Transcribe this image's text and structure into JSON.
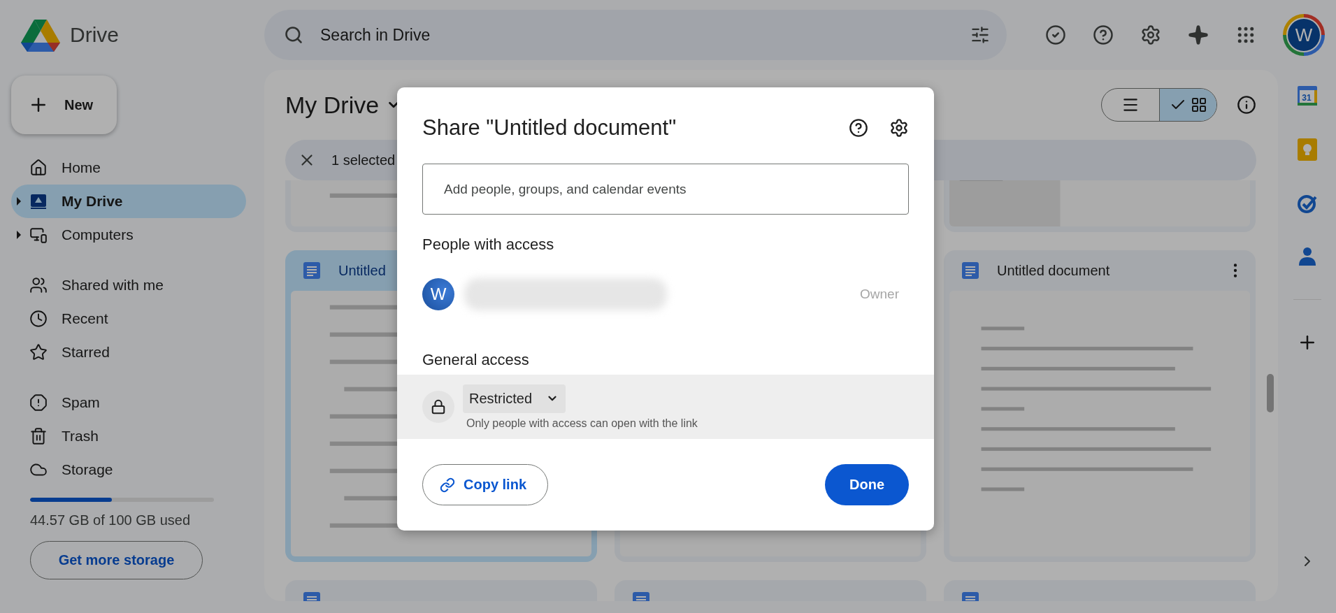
{
  "header": {
    "logo_text": "Drive",
    "search": {
      "placeholder": "Search in Drive"
    },
    "avatar": "W"
  },
  "new_button": "New",
  "nav_groups": [
    [
      {
        "label": "Home",
        "kind": "home",
        "selected": false,
        "expandable": false
      },
      {
        "label": "My Drive",
        "kind": "drive",
        "selected": true,
        "expandable": true
      },
      {
        "label": "Computers",
        "kind": "computers",
        "selected": false,
        "expandable": true
      }
    ],
    [
      {
        "label": "Shared with me",
        "kind": "shared",
        "selected": false,
        "expandable": false
      },
      {
        "label": "Recent",
        "kind": "recent",
        "selected": false,
        "expandable": false
      },
      {
        "label": "Starred",
        "kind": "starred",
        "selected": false,
        "expandable": false
      }
    ],
    [
      {
        "label": "Spam",
        "kind": "spam",
        "selected": false,
        "expandable": false
      },
      {
        "label": "Trash",
        "kind": "trash",
        "selected": false,
        "expandable": false
      },
      {
        "label": "Storage",
        "kind": "storage",
        "selected": false,
        "expandable": false
      }
    ]
  ],
  "storage": {
    "level": 0.4457,
    "text": "44.57 GB of 100 GB used",
    "button": "Get more storage"
  },
  "main": {
    "title": "My Drive",
    "view_options": [
      {
        "kind": "list",
        "selected": false
      },
      {
        "kind": "grid",
        "selected": true
      }
    ],
    "selection": {
      "text": "1 selected"
    },
    "cards": [
      {
        "selected": false
      },
      {
        "selected": false
      },
      {
        "selected": true,
        "title": "Untitled"
      },
      {
        "selected": false
      },
      {
        "selected": false,
        "title": "Untitled document",
        "menu": true
      },
      {
        "selected": false
      },
      {
        "selected": false
      },
      {
        "selected": false
      }
    ]
  },
  "rail": [
    {
      "kind": "calendar",
      "text": "31"
    },
    {
      "kind": "keep"
    },
    {
      "kind": "tasks"
    },
    {
      "kind": "contacts"
    }
  ],
  "dialog": {
    "title": "Share \"Untitled document\"",
    "add_people": {
      "placeholder": "Add people, groups, and calendar events"
    },
    "people_heading": "People with access",
    "people": [
      {
        "initial": "W",
        "role": "Owner"
      }
    ],
    "general_heading": "General access",
    "access": {
      "value": "Restricted",
      "description": "Only people with access can open with the link"
    },
    "buttons": [
      {
        "kind": "secondary",
        "label": "Copy link"
      },
      {
        "kind": "primary",
        "label": "Done"
      }
    ]
  }
}
